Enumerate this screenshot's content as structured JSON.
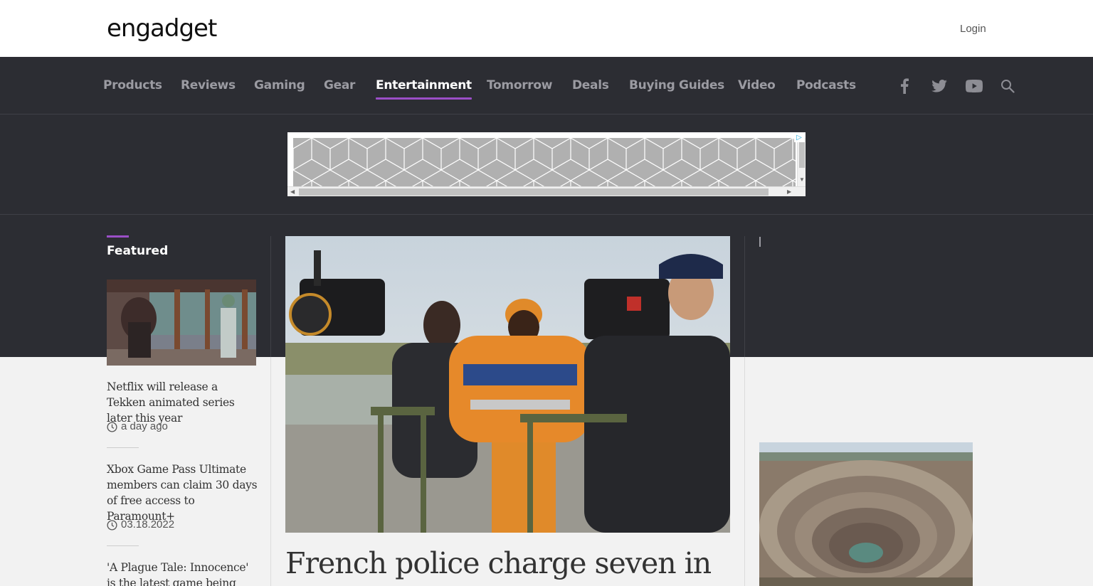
{
  "header": {
    "logo": "engadget",
    "login_label": "Login"
  },
  "nav": {
    "items": [
      {
        "label": "Products"
      },
      {
        "label": "Reviews"
      },
      {
        "label": "Gaming"
      },
      {
        "label": "Gear"
      },
      {
        "label": "Entertainment",
        "active": true
      },
      {
        "label": "Tomorrow"
      },
      {
        "label": "Deals"
      },
      {
        "label": "Buying Guides"
      },
      {
        "label": "Video"
      },
      {
        "label": "Podcasts"
      }
    ],
    "social_icons": [
      "facebook-icon",
      "twitter-icon",
      "youtube-icon",
      "search-icon"
    ]
  },
  "featured": {
    "heading": "Featured",
    "stories": [
      {
        "title": "Netflix will release a Tekken animated series later this year",
        "meta": "a day ago"
      },
      {
        "title": "Xbox Game Pass Ultimate members can claim 30 days of free access to Paramount+",
        "meta": "03.18.2022"
      },
      {
        "title": "'A Plague Tale: Innocence' is the latest game being adapted",
        "meta": ""
      }
    ]
  },
  "main": {
    "headline": "French police charge seven in"
  },
  "colors": {
    "accent": "#9b4fc7",
    "dark_bg": "#2c2d33",
    "nav_text": "#9b9ba2"
  }
}
